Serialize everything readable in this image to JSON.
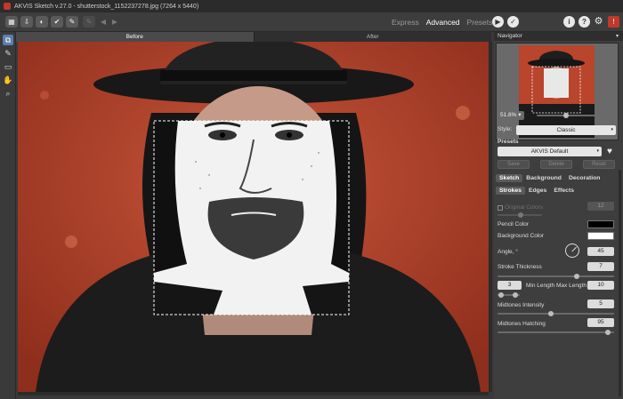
{
  "titlebar": {
    "title": "AKVIS Sketch v.27.0 - shutterstock_1152237278.jpg (7264 x 5440)"
  },
  "toolbar": {
    "modes": [
      "Express",
      "Advanced",
      "Presets"
    ],
    "active_mode": "Advanced",
    "icons": [
      "open-icon",
      "save-icon",
      "batch-icon",
      "image-icon",
      "share-icon",
      "publish-icon",
      "undo-icon",
      "redo-icon"
    ],
    "right_icons": [
      "info-icon",
      "help-icon",
      "settings-icon",
      "notification-icon"
    ]
  },
  "canvas_tabs": {
    "before": "Before",
    "after": "After"
  },
  "navigator": {
    "title": "Navigator",
    "zoom": "51.8%"
  },
  "settings": {
    "style_label": "Style:",
    "style_value": "Classic",
    "presets_label": "Presets",
    "preset_value": "AKVIS Default",
    "save_label": "Save",
    "delete_label": "Delete",
    "reset_label": "Reset",
    "main_tabs": [
      "Sketch",
      "Background",
      "Decoration"
    ],
    "sub_tabs": [
      "Strokes",
      "Edges",
      "Effects"
    ],
    "original_colors_label": "Original Colors",
    "original_colors_value": "12",
    "pencil_color_label": "Pencil Color",
    "pencil_color": "#000000",
    "background_color_label": "Background Color",
    "background_color": "#ffffff",
    "angle_label": "Angle, °",
    "angle_value": "45",
    "stroke_thickness_label": "Stroke Thickness",
    "stroke_thickness_value": "7",
    "min_length_value": "3",
    "min_length_label": "Min Length",
    "max_length_label": "Max Length",
    "max_length_value": "10",
    "midtones_intensity_label": "Midtones Intensity",
    "midtones_intensity_value": "5",
    "midtones_hatching_label": "Midtones Hatching",
    "midtones_hatching_value": "95"
  }
}
